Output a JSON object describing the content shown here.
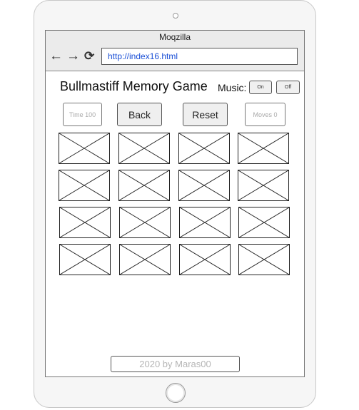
{
  "browser": {
    "title": "Moqzilla",
    "url": "http://index16.html",
    "back_icon": "arrow-left",
    "forward_icon": "arrow-right",
    "reload_icon": "reload"
  },
  "game": {
    "title": "Bullmastiff Memory Game",
    "music_label": "Music:",
    "music_on": "On",
    "music_off": "Off",
    "time": "Time 100",
    "back": "Back",
    "reset": "Reset",
    "moves": "Moves 0",
    "card_count": 16,
    "card_placeholder_icon": "image-placeholder"
  },
  "footer": {
    "text": "2020 by Maras00"
  }
}
